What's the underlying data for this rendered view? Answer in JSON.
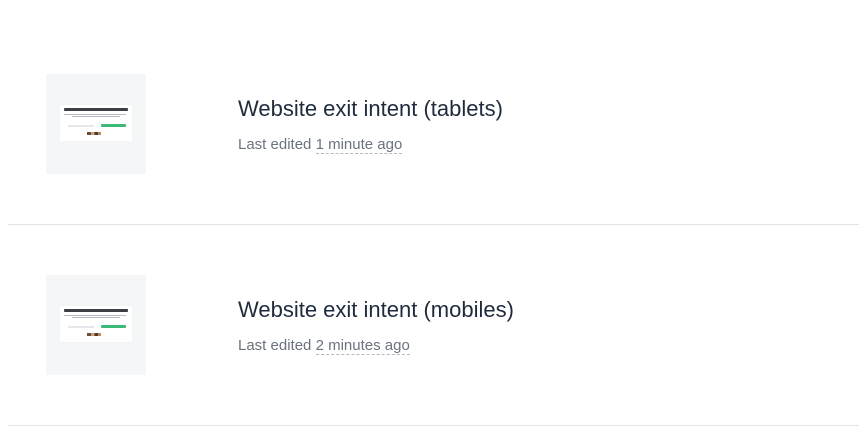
{
  "items": [
    {
      "title": "Website exit intent (tablets)",
      "edited_prefix": "Last edited",
      "edited_ago": "1 minute ago",
      "thumbnail_icon": "popup-preview-thumbnail"
    },
    {
      "title": "Website exit intent (mobiles)",
      "edited_prefix": "Last edited",
      "edited_ago": "2 minutes ago",
      "thumbnail_icon": "popup-preview-thumbnail"
    }
  ],
  "colors": {
    "title": "#1f2b3d",
    "meta": "#6b7380",
    "divider": "#e1e4ea",
    "thumb_bg": "#f5f6f7",
    "preview_button": "#3cb878"
  }
}
